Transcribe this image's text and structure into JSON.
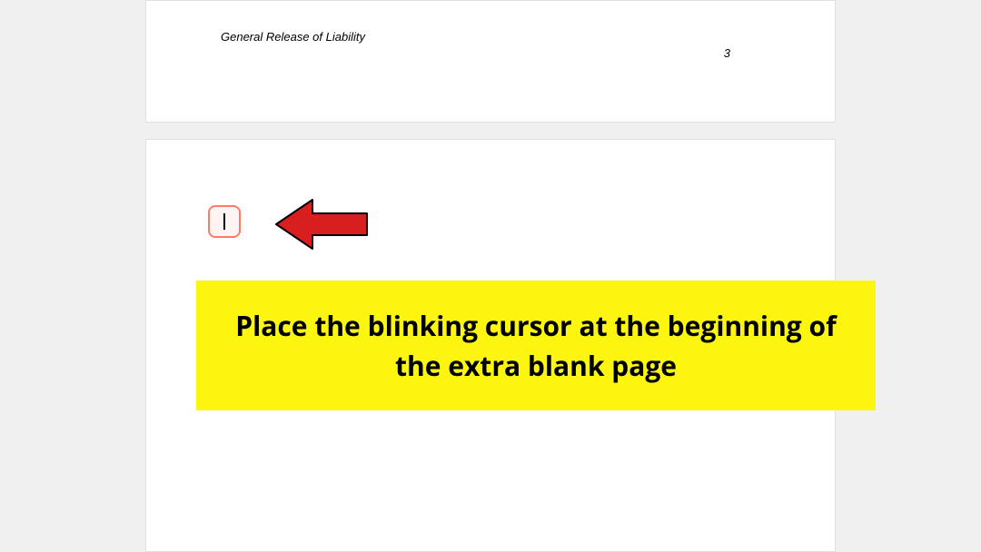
{
  "page_top": {
    "header_text": "General Release of Liability",
    "page_number": "3"
  },
  "annotation": {
    "instruction": "Place the blinking cursor at the beginning of the extra blank page"
  }
}
